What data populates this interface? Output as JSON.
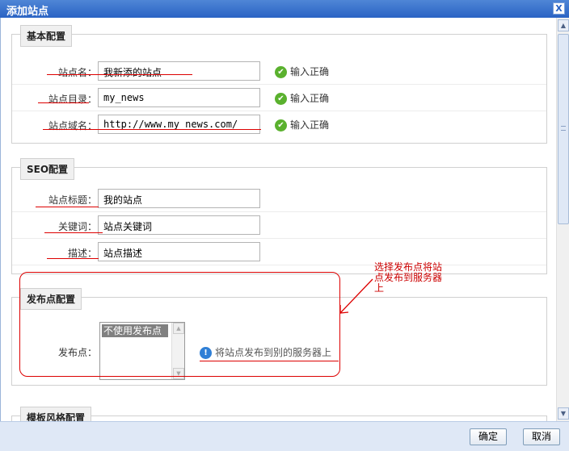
{
  "window": {
    "title": "添加站点",
    "close_glyph": "X"
  },
  "sections": {
    "basic": {
      "legend": "基本配置",
      "rows": [
        {
          "label": "站点名：",
          "value": "我新添的站点",
          "status": "输入正确"
        },
        {
          "label": "站点目录：",
          "value": "my_news",
          "status": "输入正确"
        },
        {
          "label": "站点域名：",
          "value": "http://www.my_news.com/",
          "status": "输入正确"
        }
      ]
    },
    "seo": {
      "legend": "SEO配置",
      "rows": [
        {
          "label": "站点标题：",
          "value": "我的站点"
        },
        {
          "label": "关键词：",
          "value": "站点关键词"
        },
        {
          "label": "描述：",
          "value": "站点描述"
        }
      ]
    },
    "publish": {
      "legend": "发布点配置",
      "label": "发布点：",
      "selected_option": "不使用发布点",
      "hint": "将站点发布到别的服务器上"
    },
    "template": {
      "legend": "模板风格配置"
    }
  },
  "annotation": {
    "text": "选择发布点将站点发布到服务器上",
    "color": "#cc0000"
  },
  "footer": {
    "confirm_label": "确定",
    "cancel_label": "取消"
  },
  "icons": {
    "ok": "check-circle-icon",
    "info": "info-circle-icon",
    "close": "close-icon"
  },
  "colors": {
    "titlebar": "#2a63c4",
    "annotation": "#cc0000",
    "ok": "#5ab12e",
    "info": "#2f7fd6"
  }
}
